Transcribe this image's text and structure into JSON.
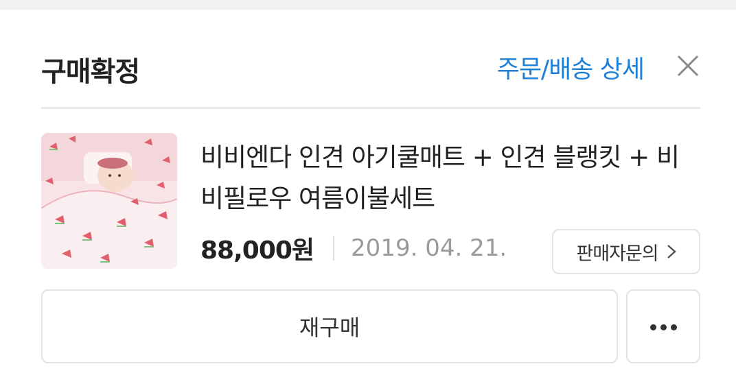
{
  "header": {
    "title": "구매확정",
    "detail_link": "주문/배송 상세",
    "close_icon": "close-icon"
  },
  "product": {
    "image_icon": "product-thumbnail",
    "name": "비비엔다 인견 아기쿨매트 + 인견 블랭킷 + 비비필로우 여름이불세트",
    "price": "88,000원",
    "date": "2019. 04. 21.",
    "seller_inquiry_label": "판매자문의",
    "seller_inquiry_icon": "chevron-right-icon"
  },
  "actions": {
    "rebuy_label": "재구매",
    "more_icon": "more-dots-icon"
  },
  "colors": {
    "accent": "#1e7fd6",
    "text": "#222222",
    "muted": "#9a9a9a",
    "border": "#e3e3e6"
  }
}
